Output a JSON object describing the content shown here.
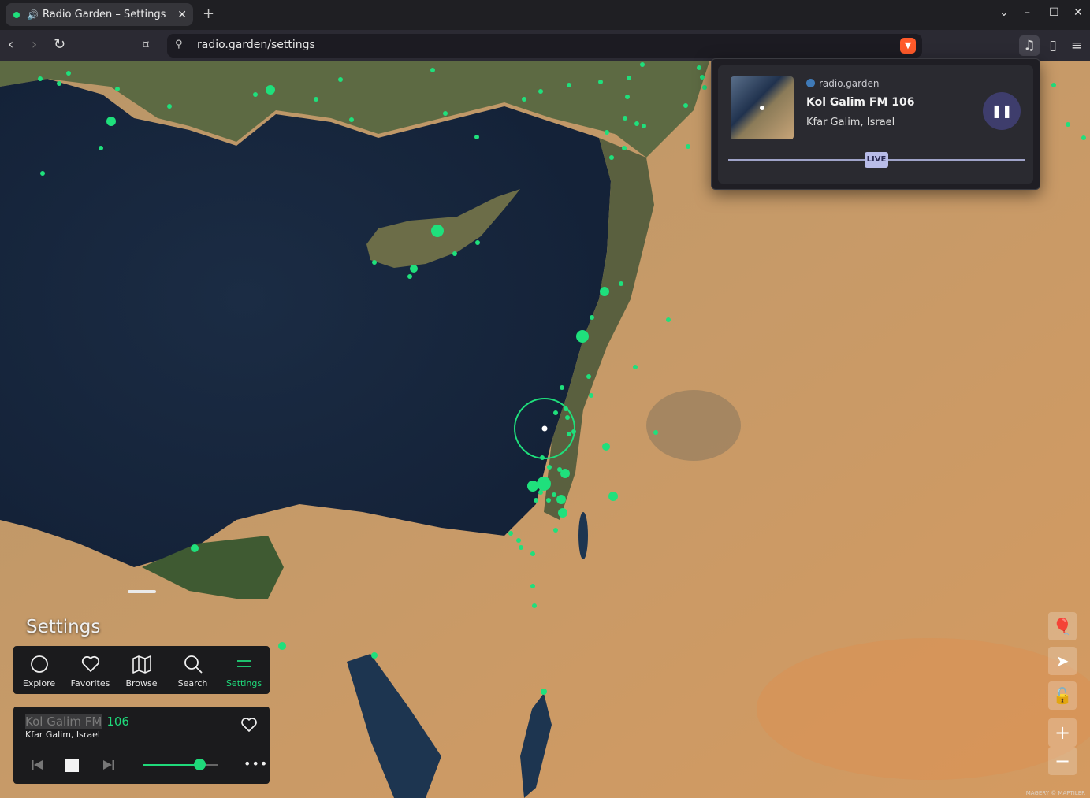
{
  "browser": {
    "tab_title": "Radio Garden – Settings",
    "tab_close": "✕",
    "new_tab": "+",
    "url": "radio.garden/settings",
    "window_controls": [
      "⌄",
      "–",
      "☐",
      "✕"
    ]
  },
  "popup": {
    "site": "radio.garden",
    "station": "Kol Galim FM 106",
    "location": "Kfar Galim, Israel",
    "live_label": "LIVE",
    "live_position": 0.5
  },
  "sidebar": {
    "title": "Settings",
    "nav": [
      {
        "label": "Explore",
        "icon": "circle-icon"
      },
      {
        "label": "Favorites",
        "icon": "heart-icon"
      },
      {
        "label": "Browse",
        "icon": "map-book-icon"
      },
      {
        "label": "Search",
        "icon": "search-icon"
      },
      {
        "label": "Settings",
        "icon": "menu-lines-icon",
        "active": true
      }
    ]
  },
  "player": {
    "station_highlight": "Kol Galim FM",
    "station_number": "106",
    "location": "Kfar Galim, Israel",
    "volume": 0.75,
    "more": "•••"
  },
  "map": {
    "attribution": "IMAGERY © MAPTILER",
    "accent_color": "#1fd97a"
  }
}
